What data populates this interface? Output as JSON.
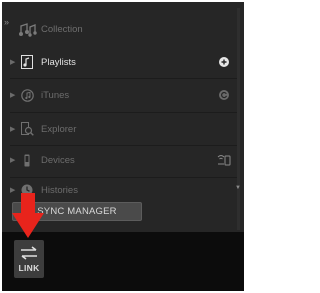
{
  "sidebar": {
    "collection_label": "Collection",
    "items": [
      {
        "label": "Playlists",
        "icon": "playlist-icon",
        "right_icon": "add-icon"
      },
      {
        "label": "iTunes",
        "icon": "itunes-icon",
        "right_icon": "refresh-icon"
      },
      {
        "label": "Explorer",
        "icon": "explorer-icon"
      },
      {
        "label": "Devices",
        "icon": "device-icon",
        "right_icon": "wireless-icon"
      },
      {
        "label": "Histories",
        "icon": "clock-icon"
      }
    ]
  },
  "sync_manager_label": "SYNC MANAGER",
  "link_label": "LINK",
  "colors": {
    "background": "#262626",
    "accent_arrow": "#e8241c",
    "text_active": "#e2e2e2",
    "text_dim": "#6c6c6c"
  }
}
